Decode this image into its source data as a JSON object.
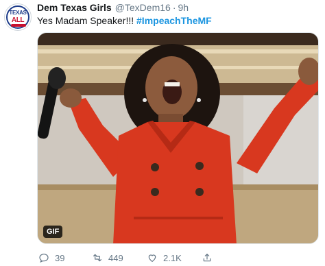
{
  "user": {
    "display_name": "Dem Texas Girls",
    "handle": "@TexDem16",
    "separator": "·",
    "time": "9h",
    "avatar_logo_top": "TEXAS",
    "avatar_logo_bottom": "ALL"
  },
  "tweet": {
    "text": "Yes Madam Speaker!!!",
    "hashtag": "#ImpeachTheMF"
  },
  "media": {
    "badge": "GIF"
  },
  "actions": {
    "reply_count": "39",
    "retweet_count": "449",
    "like_count": "2.1K"
  },
  "colors": {
    "link": "#1b95e0",
    "muted": "#657786",
    "text": "#14171a"
  }
}
